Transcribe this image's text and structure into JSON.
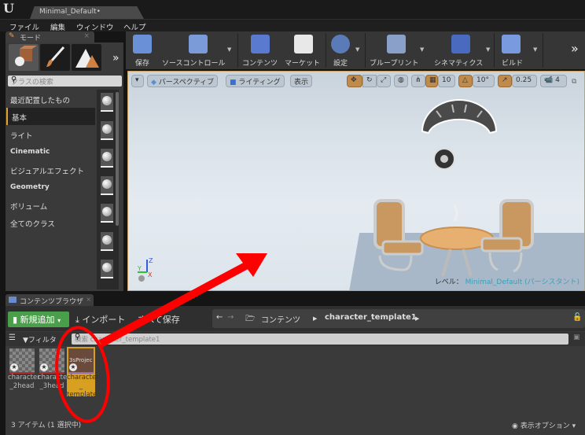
{
  "window": {
    "logo": "U",
    "document_tab": "Minimal_Default•"
  },
  "menu": [
    "ファイル",
    "編集",
    "ウィンドウ",
    "ヘルプ"
  ],
  "modes_panel": {
    "tab_label": "モード",
    "close": "×",
    "more": "»",
    "search_placeholder": "クラスの検索",
    "categories": [
      {
        "label": "最近配置したもの",
        "selected": false
      },
      {
        "label": "基本",
        "selected": true
      },
      {
        "label": "ライト",
        "selected": false
      },
      {
        "label": "Cinematic",
        "selected": false
      },
      {
        "label": "ビジュアルエフェクト",
        "selected": false
      },
      {
        "label": "Geometry",
        "selected": false
      },
      {
        "label": "ボリューム",
        "selected": false
      },
      {
        "label": "全てのクラス",
        "selected": false
      }
    ]
  },
  "toolbar": {
    "buttons": [
      {
        "label": "保存",
        "icon": "save-icon"
      },
      {
        "label": "ソースコントロール",
        "icon": "source-control-icon"
      },
      {
        "label": "コンテンツ",
        "icon": "content-icon"
      },
      {
        "label": "マーケット",
        "icon": "marketplace-icon"
      },
      {
        "label": "設定",
        "icon": "settings-icon"
      },
      {
        "label": "ブループリント",
        "icon": "blueprint-icon"
      },
      {
        "label": "シネマティクス",
        "icon": "cinematics-icon"
      },
      {
        "label": "ビルド",
        "icon": "build-icon"
      }
    ],
    "more": "»"
  },
  "viewport": {
    "perspective": "パースペクティブ",
    "lighting": "ライティング",
    "show": "表示",
    "grid_snap": "10",
    "rotation_snap": "10°",
    "scale_snap": "0.25",
    "camera_speed": "4",
    "level_label": "レベル：",
    "level_name": "Minimal_Default (パーシスタント)",
    "axis": {
      "z": "Z",
      "y": "Y",
      "x": "X"
    }
  },
  "content_browser": {
    "tab_label": "コンテンツブラウザ",
    "add_new": "新規追加",
    "import": "インポート",
    "save_all": "すべて保存",
    "breadcrumb": [
      "コンテンツ",
      "character_template1"
    ],
    "filters": "フィルタ",
    "search_placeholder": "検索 character_template1",
    "assets": [
      {
        "name": "character_2head",
        "line1": "character",
        "line2": "_2head",
        "selected": false
      },
      {
        "name": "character_3head",
        "line1": "character",
        "line2": "_3head",
        "selected": false
      },
      {
        "name": "character_template",
        "line1": "character",
        "line2": "_",
        "line3": "template",
        "thumb_text": "3sProjec",
        "selected": true
      }
    ],
    "status": "3 アイテム (1 選択中)",
    "view_options": "表示オプション"
  },
  "colors": {
    "accent_orange": "#e0a030",
    "add_new_green": "#4aa04a",
    "annotation_red": "#ff0000",
    "level_name": "#3aa0b8"
  }
}
